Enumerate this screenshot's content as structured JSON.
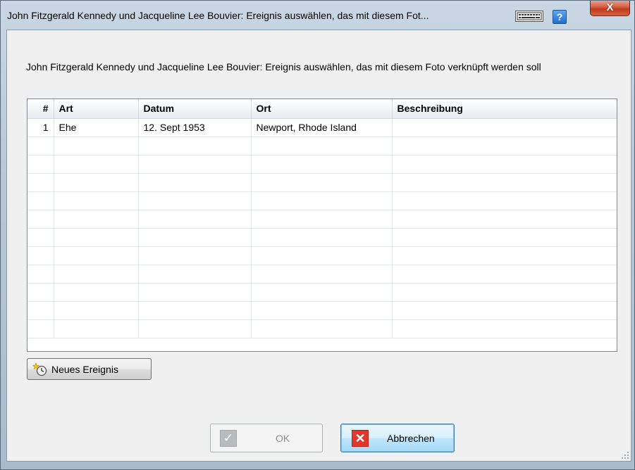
{
  "window": {
    "title": "John Fitzgerald Kennedy und Jacqueline Lee Bouvier: Ereignis auswählen, das mit diesem Fot...",
    "close_label": "X",
    "help_label": "?"
  },
  "instruction": "John Fitzgerald Kennedy und Jacqueline Lee Bouvier: Ereignis auswählen, das mit diesem Foto verknüpft werden soll",
  "table": {
    "columns": [
      "#",
      "Art",
      "Datum",
      "Ort",
      "Beschreibung"
    ],
    "rows": [
      [
        "1",
        "Ehe",
        "12. Sept 1953",
        "Newport, Rhode Island",
        ""
      ]
    ]
  },
  "buttons": {
    "new_event": "Neues Ereignis",
    "ok": "OK",
    "cancel": "Abbrechen"
  },
  "icons": {
    "keyboard": "keyboard-icon",
    "help": "help-icon",
    "close": "close-icon",
    "new_event": "new-event-icon",
    "ok": "checkmark-icon",
    "cancel": "x-icon"
  },
  "colors": {
    "cancel_icon": "#e0392b",
    "help_icon": "#1f6fd0",
    "close_button": "#c0391c"
  }
}
